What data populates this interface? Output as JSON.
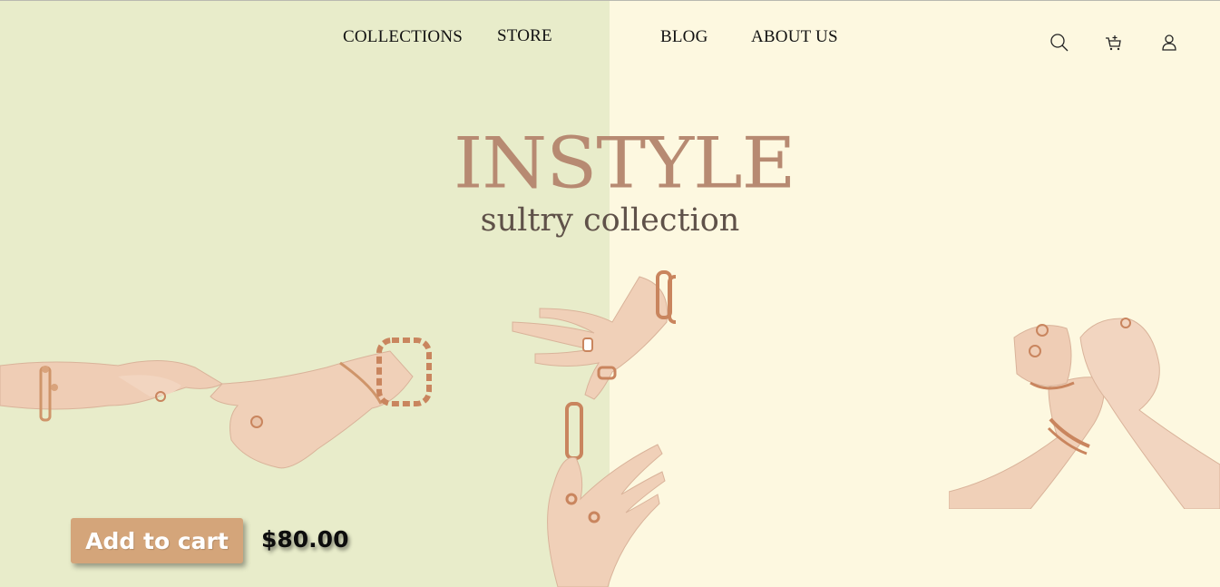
{
  "nav": {
    "items": [
      {
        "label": "COLLECTIONS"
      },
      {
        "label": "STORE"
      },
      {
        "label": "BLOG"
      },
      {
        "label": "ABOUT US"
      }
    ]
  },
  "header_icons": [
    "search-icon",
    "cart-icon",
    "user-icon"
  ],
  "hero": {
    "brand": "INSTYLE",
    "subtitle": "sultry collection"
  },
  "product": {
    "add_to_cart_label": "Add to cart",
    "price": "$80.00"
  },
  "colors": {
    "left_background": "#e8ecca",
    "right_background": "#fdf8e0",
    "brand_text": "#b78a72",
    "subtitle_text": "#5f5149",
    "button_background": "#d4a57a"
  }
}
